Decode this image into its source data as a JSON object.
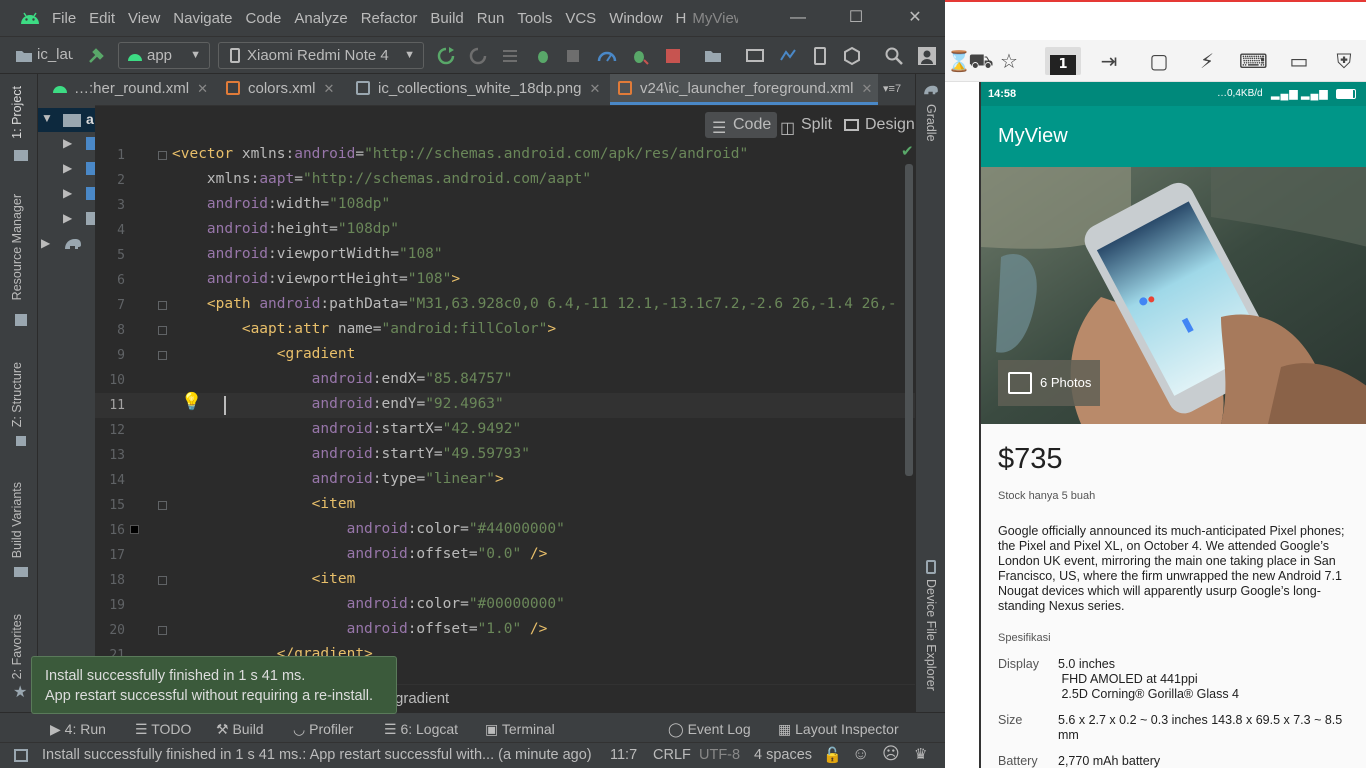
{
  "ide": {
    "menu": [
      "File",
      "Edit",
      "View",
      "Navigate",
      "Code",
      "Analyze",
      "Refactor",
      "Build",
      "Run",
      "Tools",
      "VCS",
      "Window",
      "H"
    ],
    "project_title": "MyView",
    "toolbar": {
      "module_label": "ic_lau",
      "config_label": "app",
      "device_label": "Xiaomi Redmi Note 4"
    },
    "left_tabs": [
      "1: Project",
      "Resource Manager",
      "Z: Structure",
      "Build Variants",
      "2: Favorites"
    ],
    "right_tabs": [
      "Gradle",
      "Device File Explorer"
    ],
    "project_root_letter": "a",
    "tabs": [
      {
        "label": "…:her_round.xml",
        "active": false
      },
      {
        "label": "colors.xml",
        "active": false
      },
      {
        "label": "ic_collections_white_18dp.png",
        "active": false
      },
      {
        "label": "v24\\ic_launcher_foreground.xml",
        "active": true
      }
    ],
    "tab_overflow": "7",
    "modes": {
      "code": "Code",
      "split": "Split",
      "design": "Design"
    },
    "lines": [
      "1",
      "2",
      "3",
      "4",
      "5",
      "6",
      "7",
      "8",
      "9",
      "10",
      "11",
      "12",
      "13",
      "14",
      "15",
      "16",
      "17",
      "18",
      "19",
      "20",
      "21"
    ],
    "code": {
      "l1_tag": "<vector",
      "l1_attr": " xmlns:",
      "l1_ns": "android",
      "l1_eq": "=",
      "l1_val": "\"http://schemas.android.com/apk/res/android\"",
      "l2_attr": "    xmlns:",
      "l2_ns": "aapt",
      "l2_eq": "=",
      "l2_val": "\"http://schemas.android.com/aapt\"",
      "l3_ns": "    android",
      "l3_attr": ":width",
      "l3_eq": "=",
      "l3_val": "\"108dp\"",
      "l4_ns": "    android",
      "l4_attr": ":height",
      "l4_eq": "=",
      "l4_val": "\"108dp\"",
      "l5_ns": "    android",
      "l5_attr": ":viewportWidth",
      "l5_eq": "=",
      "l5_val": "\"108\"",
      "l6_ns": "    android",
      "l6_attr": ":viewportHeight",
      "l6_eq": "=",
      "l6_val": "\"108\"",
      "l6_close": ">",
      "l7_tag": "    <path ",
      "l7_ns": "android",
      "l7_attr": ":pathData",
      "l7_eq": "=",
      "l7_val": "\"M31,63.928c0,0 6.4,-11 12.1,-13.1c7.2,-2.6 26,-1.4 26,-",
      "l8_tag": "        <aapt:attr ",
      "l8_attr": "name",
      "l8_eq": "=",
      "l8_val": "\"android:fillColor\"",
      "l8_close": ">",
      "l9_tag": "            <gradient",
      "l10_ns": "                android",
      "l10_attr": ":endX",
      "l10_eq": "=",
      "l10_val": "\"85.84757\"",
      "l11_ns": "                android",
      "l11_attr": ":endY",
      "l11_eq": "=",
      "l11_val": "\"92.4963\"",
      "l12_ns": "                android",
      "l12_attr": ":startX",
      "l12_eq": "=",
      "l12_val": "\"42.9492\"",
      "l13_ns": "                android",
      "l13_attr": ":startY",
      "l13_eq": "=",
      "l13_val": "\"49.59793\"",
      "l14_ns": "                android",
      "l14_attr": ":type",
      "l14_eq": "=",
      "l14_val": "\"linear\"",
      "l14_close": ">",
      "l15_tag": "                <item",
      "l16_ns": "                    android",
      "l16_attr": ":color",
      "l16_eq": "=",
      "l16_val": "\"#44000000\"",
      "l17_ns": "                    android",
      "l17_attr": ":offset",
      "l17_eq": "=",
      "l17_val": "\"0.0\"",
      "l17_close": " />",
      "l18_tag": "                <item",
      "l19_ns": "                    android",
      "l19_attr": ":color",
      "l19_eq": "=",
      "l19_val": "\"#00000000\"",
      "l20_ns": "                    android",
      "l20_attr": ":offset",
      "l20_eq": "=",
      "l20_val": "\"1.0\"",
      "l20_close": " />",
      "l21_tag": "            </gradient>"
    },
    "breadcrumb": "gradient",
    "toast": {
      "line1": "Install successfully finished in 1 s 41 ms.",
      "line2": "App restart successful without requiring a re-install."
    },
    "toolwindows": {
      "run": "4: Run",
      "todo": "TODO",
      "build": "Build",
      "profiler": "Profiler",
      "logcat": "6: Logcat",
      "terminal": "Terminal",
      "event_log": "Event Log",
      "layout_inspector": "Layout Inspector"
    },
    "status": {
      "message": "Install successfully finished in 1 s 41 ms.: App restart successful with... (a minute ago)",
      "position": "11:7",
      "line_sep": "CRLF",
      "encoding": "UTF-8",
      "indent": "4 spaces"
    }
  },
  "emulator": {
    "device_button": "1",
    "status_time": "14:58",
    "status_net": "…0,4KB/d",
    "app_title": "MyView",
    "photos_label": "6 Photos",
    "price": "$735",
    "stock": "Stock hanya 5 buah",
    "description": "Google officially announced its much-anticipated Pixel phones; the Pixel and Pixel XL, on October 4. We attended Google’s London UK event, mirroring the main one taking place in San Francisco, US, where the firm unwrapped the new Android 7.1 Nougat devices which will apparently usurp Google’s long-standing Nexus series.",
    "spec_heading": "Spesifikasi",
    "specs": [
      {
        "label": "Display",
        "lines": [
          "5.0 inches",
          " FHD AMOLED at 441ppi",
          " 2.5D Corning® Gorilla® Glass 4"
        ]
      },
      {
        "label": "Size",
        "lines": [
          "5.6 x 2.7 x 0.2 ~ 0.3 inches 143.8 x 69.5 x 7.3 ~ 8.5",
          "mm"
        ]
      },
      {
        "label": "Battery",
        "lines": [
          "2,770 mAh battery"
        ]
      }
    ]
  },
  "colors": {
    "teal": "#009688",
    "teal_dark": "#00897b",
    "ide_bg": "#2b2b2b",
    "xml_tag": "#e8bf6a",
    "xml_value": "#6a8759",
    "xml_ns": "#9876aa"
  }
}
